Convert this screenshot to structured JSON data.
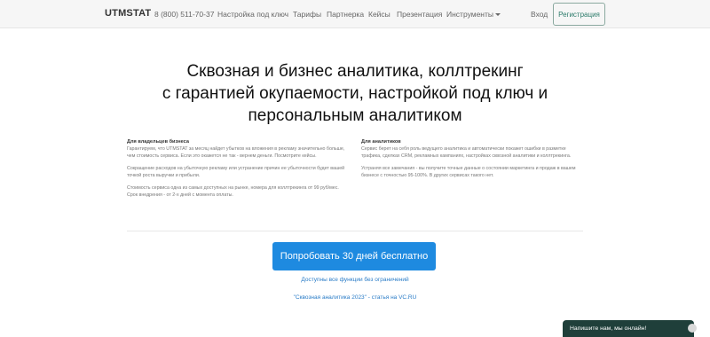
{
  "nav": {
    "brand": "UTMSTAT",
    "phone": "8 (800) 511-70-37",
    "items": [
      "Настройка под ключ",
      "Тарифы",
      "Партнерка",
      "Кейсы",
      "Презентация",
      "Инструменты"
    ],
    "login": "Вход",
    "register": "Регистрация"
  },
  "hero": {
    "line1": "Сквозная и бизнес аналитика, коллтрекинг",
    "line2": "с гарантией окупаемости, настройкой под ключ и",
    "line3": "персональным аналитиком"
  },
  "left_col": {
    "title": "Для владельцев бизнеса",
    "p1": "Гарантируем, что UTMSTAT за месяц найдет убытков на вложения в рекламу значительно больше, чем стоимость сервиса. Если это окажется не так - вернем деньги. Посмотрите кейсы.",
    "p2": "Сокращение расходов на убыточную рекламу или устранение причин ее убыточности будет вашей точкой роста выручки и прибыли.",
    "p3": "Стоимость сервиса одна из самых доступных на рынке, номера для коллтрекинга от 99 руб/мес. Срок внедрения - от 2-х дней с момента оплаты."
  },
  "right_col": {
    "title": "Для аналитиков",
    "p1": "Сервис берет на себя роль ведущего аналитика и автоматически покажет ошибки в разметке трафика, сделках CRM, рекламных кампаниях, настройках сквозной аналитики и коллтрекинга.",
    "p2": "Устраняя все замечания - вы получите точные данные о состоянии маркетинга и продаж в вашем бизнесе с точностью 95-100%. В других сервисах такого нет."
  },
  "cta": {
    "button": "Попробовать 30 дней бесплатно",
    "note": "Доступны все функции без ограничений",
    "article": "\"Сквозная аналитика 2023\" - статья на VC.RU"
  },
  "chat": {
    "label": "Напишите нам, мы онлайн!"
  }
}
